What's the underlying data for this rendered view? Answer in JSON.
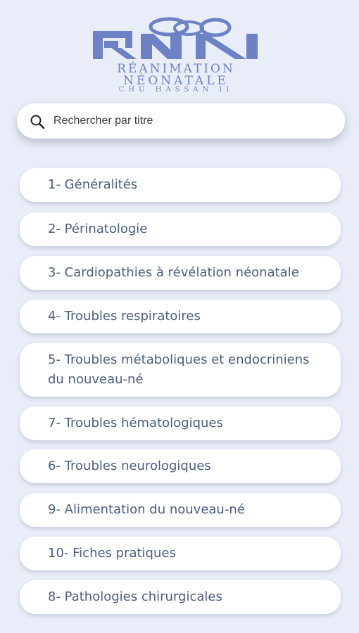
{
  "brand": {
    "logo_initials": "RNN",
    "line1": "RÉANIMATION",
    "line2": "NÉONATALE",
    "line3": "CHU HASSAN II",
    "color": "#6d82c4"
  },
  "search": {
    "placeholder": "Rechercher par titre",
    "icon": "search-icon"
  },
  "chapters": [
    {
      "label": "1- Généralités"
    },
    {
      "label": "2- Périnatologie"
    },
    {
      "label": "3- Cardiopathies à révélation néonatale"
    },
    {
      "label": "4- Troubles respiratoires"
    },
    {
      "label": "5- Troubles métaboliques et endocriniens du nouveau-né"
    },
    {
      "label": "7- Troubles hématologiques"
    },
    {
      "label": "6- Troubles neurologiques"
    },
    {
      "label": "9- Alimentation du nouveau-né"
    },
    {
      "label": "10- Fiches pratiques"
    },
    {
      "label": "8- Pathologies chirurgicales"
    }
  ],
  "colors": {
    "background": "#e9edf8",
    "card": "#ffffff",
    "text": "#4a5e82"
  }
}
